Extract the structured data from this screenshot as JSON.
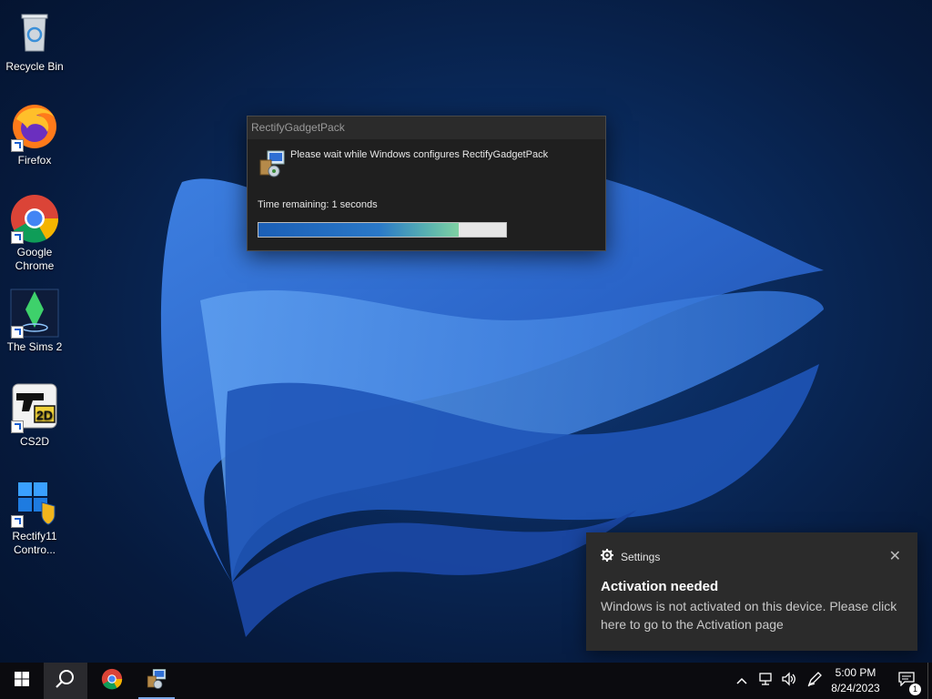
{
  "desktop": {
    "icons": [
      {
        "label": "Recycle Bin",
        "icon": "recycle-bin-icon"
      },
      {
        "label": "Firefox",
        "icon": "firefox-icon"
      },
      {
        "label_line1": "Google",
        "label_line2": "Chrome",
        "icon": "chrome-icon"
      },
      {
        "label": "The Sims 2",
        "icon": "sims2-icon"
      },
      {
        "label": "CS2D",
        "icon": "cs2d-icon"
      },
      {
        "label_line1": "Rectify11",
        "label_line2": "Contro...",
        "icon": "rectify11-icon"
      }
    ]
  },
  "installer": {
    "title": "RectifyGadgetPack",
    "message": "Please wait while Windows configures RectifyGadgetPack",
    "time_remaining": "Time remaining: 1 seconds",
    "progress_fraction": 0.81
  },
  "toast": {
    "app_name": "Settings",
    "close_glyph": "✕",
    "title": "Activation needed",
    "body": "Windows is not activated on this device. Please click here to go to the Activation page"
  },
  "taskbar": {
    "pinned": [
      "start-button",
      "search-button",
      "chrome-taskbar-button",
      "installer-taskbar-button"
    ],
    "clock_time": "5:00 PM",
    "clock_date": "8/24/2023",
    "notification_count": "1"
  },
  "colors": {
    "accent": "#1b5fb6",
    "taskbar": "#0b0b0f",
    "toast_bg": "#2b2b2b"
  }
}
